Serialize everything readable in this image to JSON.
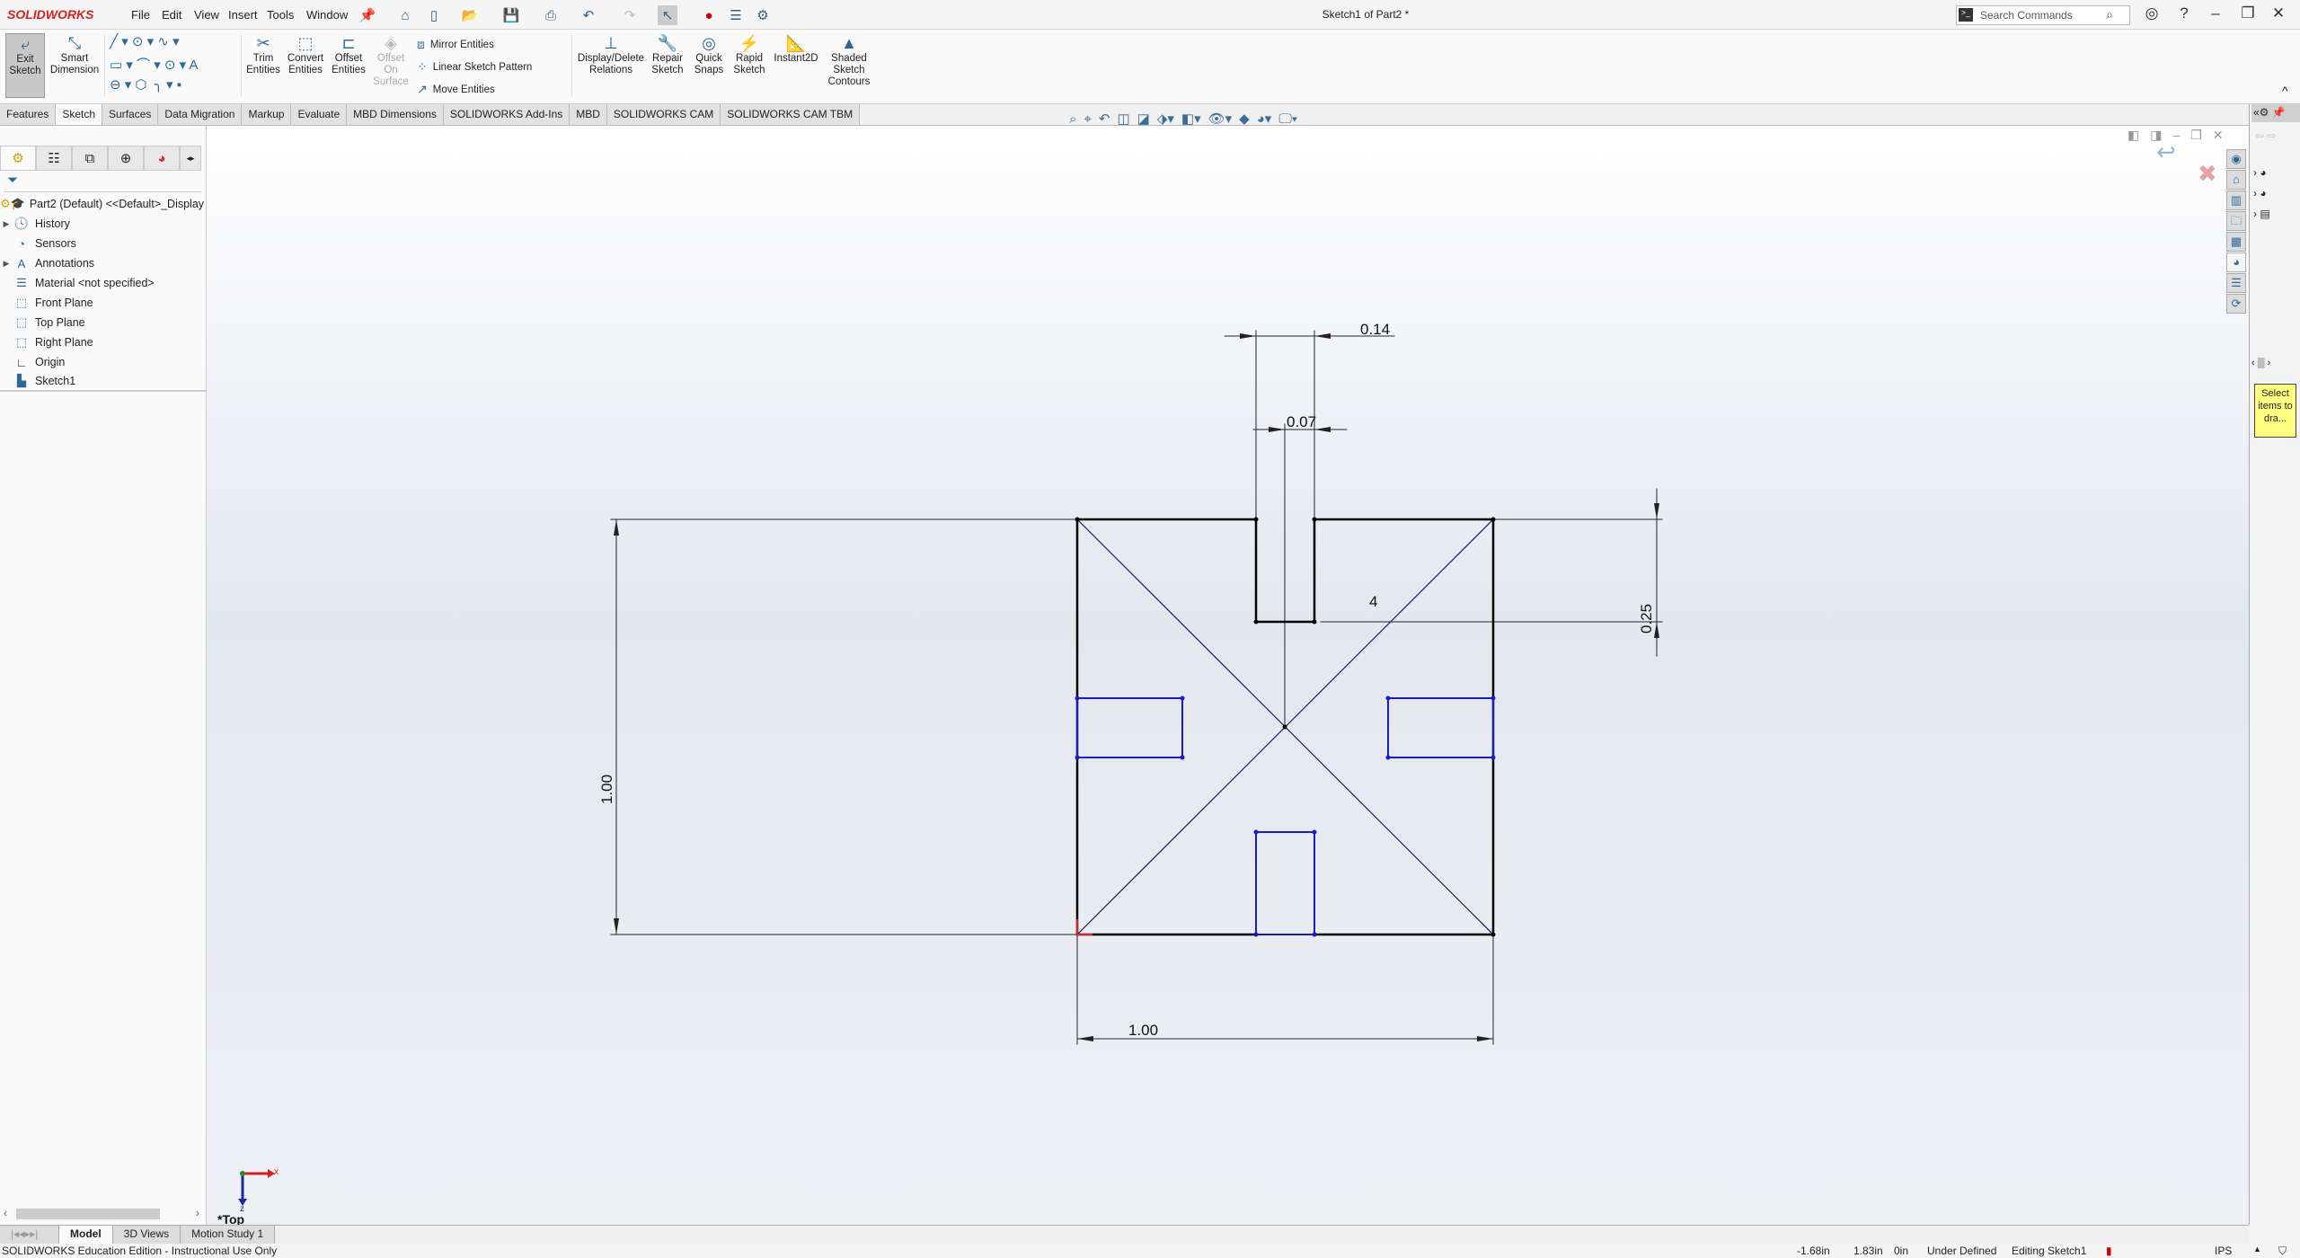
{
  "app": {
    "logo": "SOLIDWORKS",
    "title": "Sketch1 of Part2 *"
  },
  "menu": [
    "File",
    "Edit",
    "View",
    "Insert",
    "Tools",
    "Window"
  ],
  "search": {
    "placeholder": "Search Commands"
  },
  "ribbon": {
    "exit_sketch": "Exit Sketch",
    "smart_dimension": "Smart Dimension",
    "trim": "Trim Entities",
    "convert": "Convert Entities",
    "offset": "Offset Entities",
    "offset_surface": "Offset On Surface",
    "mirror": "Mirror Entities",
    "linear_pattern": "Linear Sketch Pattern",
    "move": "Move Entities",
    "display_relations": "Display/Delete Relations",
    "repair": "Repair Sketch",
    "quick_snaps": "Quick Snaps",
    "rapid": "Rapid Sketch",
    "instant2d": "Instant2D",
    "shaded": "Shaded Sketch Contours"
  },
  "tabs": [
    "Features",
    "Sketch",
    "Surfaces",
    "Data Migration",
    "Markup",
    "Evaluate",
    "MBD Dimensions",
    "SOLIDWORKS Add-Ins",
    "MBD",
    "SOLIDWORKS CAM",
    "SOLIDWORKS CAM TBM"
  ],
  "active_tab": "Sketch",
  "tree": {
    "root": "Part2 (Default) <<Default>_Display State 1>",
    "items": [
      "History",
      "Sensors",
      "Annotations",
      "Material <not specified>",
      "Front Plane",
      "Top Plane",
      "Right Plane",
      "Origin",
      "Sketch1"
    ]
  },
  "sketch": {
    "dims": {
      "top_width": "0.14",
      "half_width": "0.07",
      "slot_depth": "0.25",
      "height": "1.00",
      "width": "1.00",
      "count": "4"
    },
    "colors": {
      "defined": "#000000",
      "under_defined": "#1a1acc",
      "origin": "#e02020"
    }
  },
  "view": {
    "name": "*Top",
    "axes": {
      "x": "x",
      "z": "z"
    }
  },
  "taskpane": {
    "tooltip": "Select items to dra..."
  },
  "bottom_tabs": [
    "Model",
    "3D Views",
    "Motion Study 1"
  ],
  "status": {
    "edition": "SOLIDWORKS Education Edition - Instructional Use Only",
    "x": "-1.68in",
    "y": "1.83in",
    "z": "0in",
    "state": "Under Defined",
    "mode": "Editing Sketch1",
    "units": "IPS"
  }
}
